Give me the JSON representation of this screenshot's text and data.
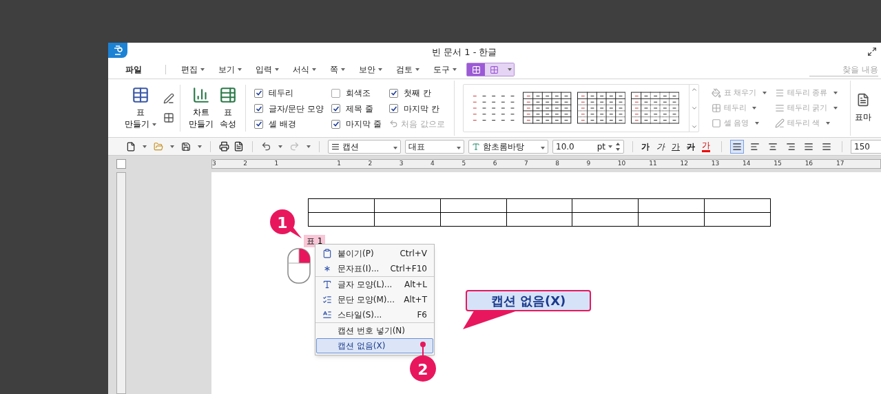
{
  "window": {
    "title": "빈 문서 1 - 한글"
  },
  "menu": {
    "file": "파일",
    "items": [
      {
        "label": "편집"
      },
      {
        "label": "보기"
      },
      {
        "label": "입력"
      },
      {
        "label": "서식"
      },
      {
        "label": "쪽"
      },
      {
        "label": "보안"
      },
      {
        "label": "검토"
      },
      {
        "label": "도구"
      }
    ],
    "context_tabs": [
      {
        "selected": true
      },
      {
        "selected": false
      }
    ],
    "search": {
      "placeholder": "찾을 내용"
    }
  },
  "ribbon": {
    "big_buttons": [
      {
        "lines": [
          "표",
          "만들기"
        ],
        "caret": true
      },
      {
        "lines": [
          "차트",
          "만들기"
        ],
        "caret": false
      },
      {
        "lines": [
          "표",
          "속성"
        ],
        "caret": false
      }
    ],
    "checkboxes": [
      {
        "label": "테두리",
        "checked": true
      },
      {
        "label": "글자/문단 모양",
        "checked": true
      },
      {
        "label": "셀 배경",
        "checked": true
      },
      {
        "label": "회색조",
        "checked": false
      },
      {
        "label": "제목 줄",
        "checked": true
      },
      {
        "label": "마지막 줄",
        "checked": true
      },
      {
        "label": "첫째 칸",
        "checked": true
      },
      {
        "label": "마지막 칸",
        "checked": true
      }
    ],
    "reset": {
      "label": "처음 값으로",
      "disabled": true
    },
    "tools": [
      {
        "label": "표 채우기",
        "disabled": true
      },
      {
        "label": "테두리 종류",
        "disabled": true
      },
      {
        "label": "테두리",
        "disabled": true
      },
      {
        "label": "테두리 굵기",
        "disabled": true
      },
      {
        "label": "셀 음영",
        "disabled": true
      },
      {
        "label": "테두리 색",
        "disabled": true
      }
    ],
    "cut_button": "표마"
  },
  "toolbar": {
    "style": "캡션",
    "language": "대표",
    "font": "함초롬바탕",
    "size": "10.0",
    "unit": "pt",
    "formats": [
      {
        "kind": "bold",
        "label": "가"
      },
      {
        "kind": "italic",
        "label": "가"
      },
      {
        "kind": "underline",
        "label": "가"
      },
      {
        "kind": "strike",
        "label": "가"
      },
      {
        "kind": "color",
        "label": "가"
      }
    ],
    "aligns": [
      {
        "selected": true
      },
      {
        "selected": false
      },
      {
        "selected": false
      },
      {
        "selected": false
      },
      {
        "selected": false
      },
      {
        "selected": false
      }
    ],
    "zoom": "150"
  },
  "ruler": {
    "left_labels": [
      "3",
      "2",
      "1"
    ],
    "right_labels": [
      "1",
      "2",
      "3",
      "4",
      "5",
      "6",
      "7",
      "8",
      "9",
      "10",
      "11",
      "12",
      "13",
      "14",
      "15",
      "16",
      "17"
    ]
  },
  "document": {
    "caption": "표 1"
  },
  "context_menu": {
    "groups": [
      [
        {
          "label": "붙이기(P)",
          "shortcut": "Ctrl+V",
          "selected": false
        },
        {
          "label": "문자표(I)...",
          "shortcut": "Ctrl+F10",
          "selected": false
        }
      ],
      [
        {
          "label": "글자 모양(L)...",
          "shortcut": "Alt+L",
          "selected": false
        },
        {
          "label": "문단 모양(M)...",
          "shortcut": "Alt+T",
          "selected": false
        },
        {
          "label": "스타일(S)...",
          "shortcut": "F6",
          "selected": false
        }
      ],
      [
        {
          "label": "캡션 번호 넣기(N)",
          "selected": false
        },
        {
          "label": "캡션 없음(X)",
          "selected": true
        }
      ]
    ]
  },
  "annotations": {
    "steps": [
      "1",
      "2"
    ],
    "callout": "캡션 없음(X)"
  }
}
